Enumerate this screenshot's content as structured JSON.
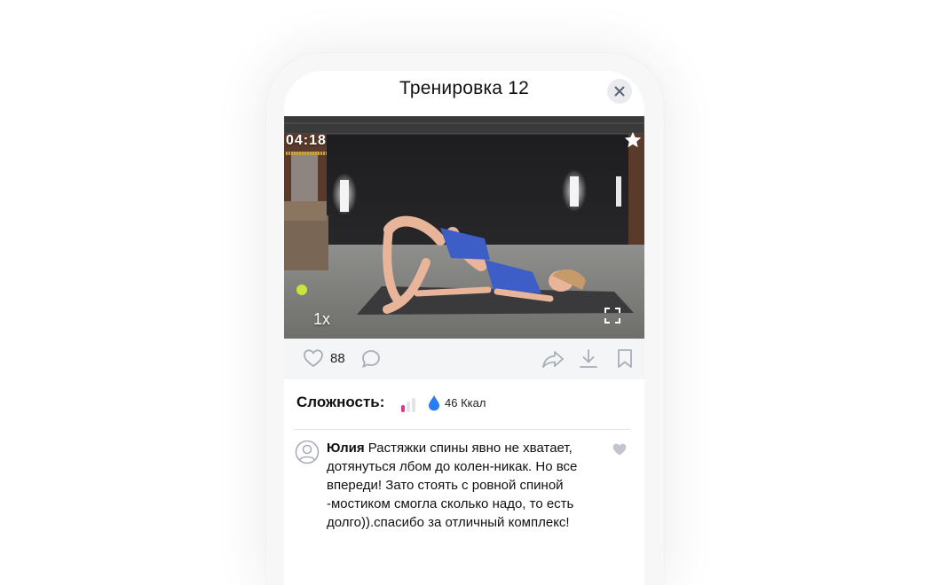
{
  "header": {
    "title": "Тренировка 12"
  },
  "video": {
    "timer": "04:18",
    "speed": "1x"
  },
  "actions": {
    "likes": "88"
  },
  "meta": {
    "label": "Сложность:",
    "kcal": "46 Ккал",
    "difficulty_level": 1,
    "difficulty_max": 3
  },
  "comment": {
    "author": "Юлия",
    "text": "Растяжки спины явно не хватает, дотянуться лбом до колен-никак. Но все впереди! Зато стоять с ровной спиной -мостиком смогла сколько надо, то есть долго)).спасибо за отличный комплекс!"
  },
  "colors": {
    "accent_pink": "#e0338a",
    "water_blue": "#2b7bf5",
    "icon_grey": "#a9adb8"
  },
  "icons": [
    "close-icon",
    "star-icon",
    "fullscreen-icon",
    "heart-icon",
    "comment-icon",
    "share-icon",
    "download-icon",
    "bookmark-icon",
    "drop-icon",
    "avatar-icon"
  ]
}
